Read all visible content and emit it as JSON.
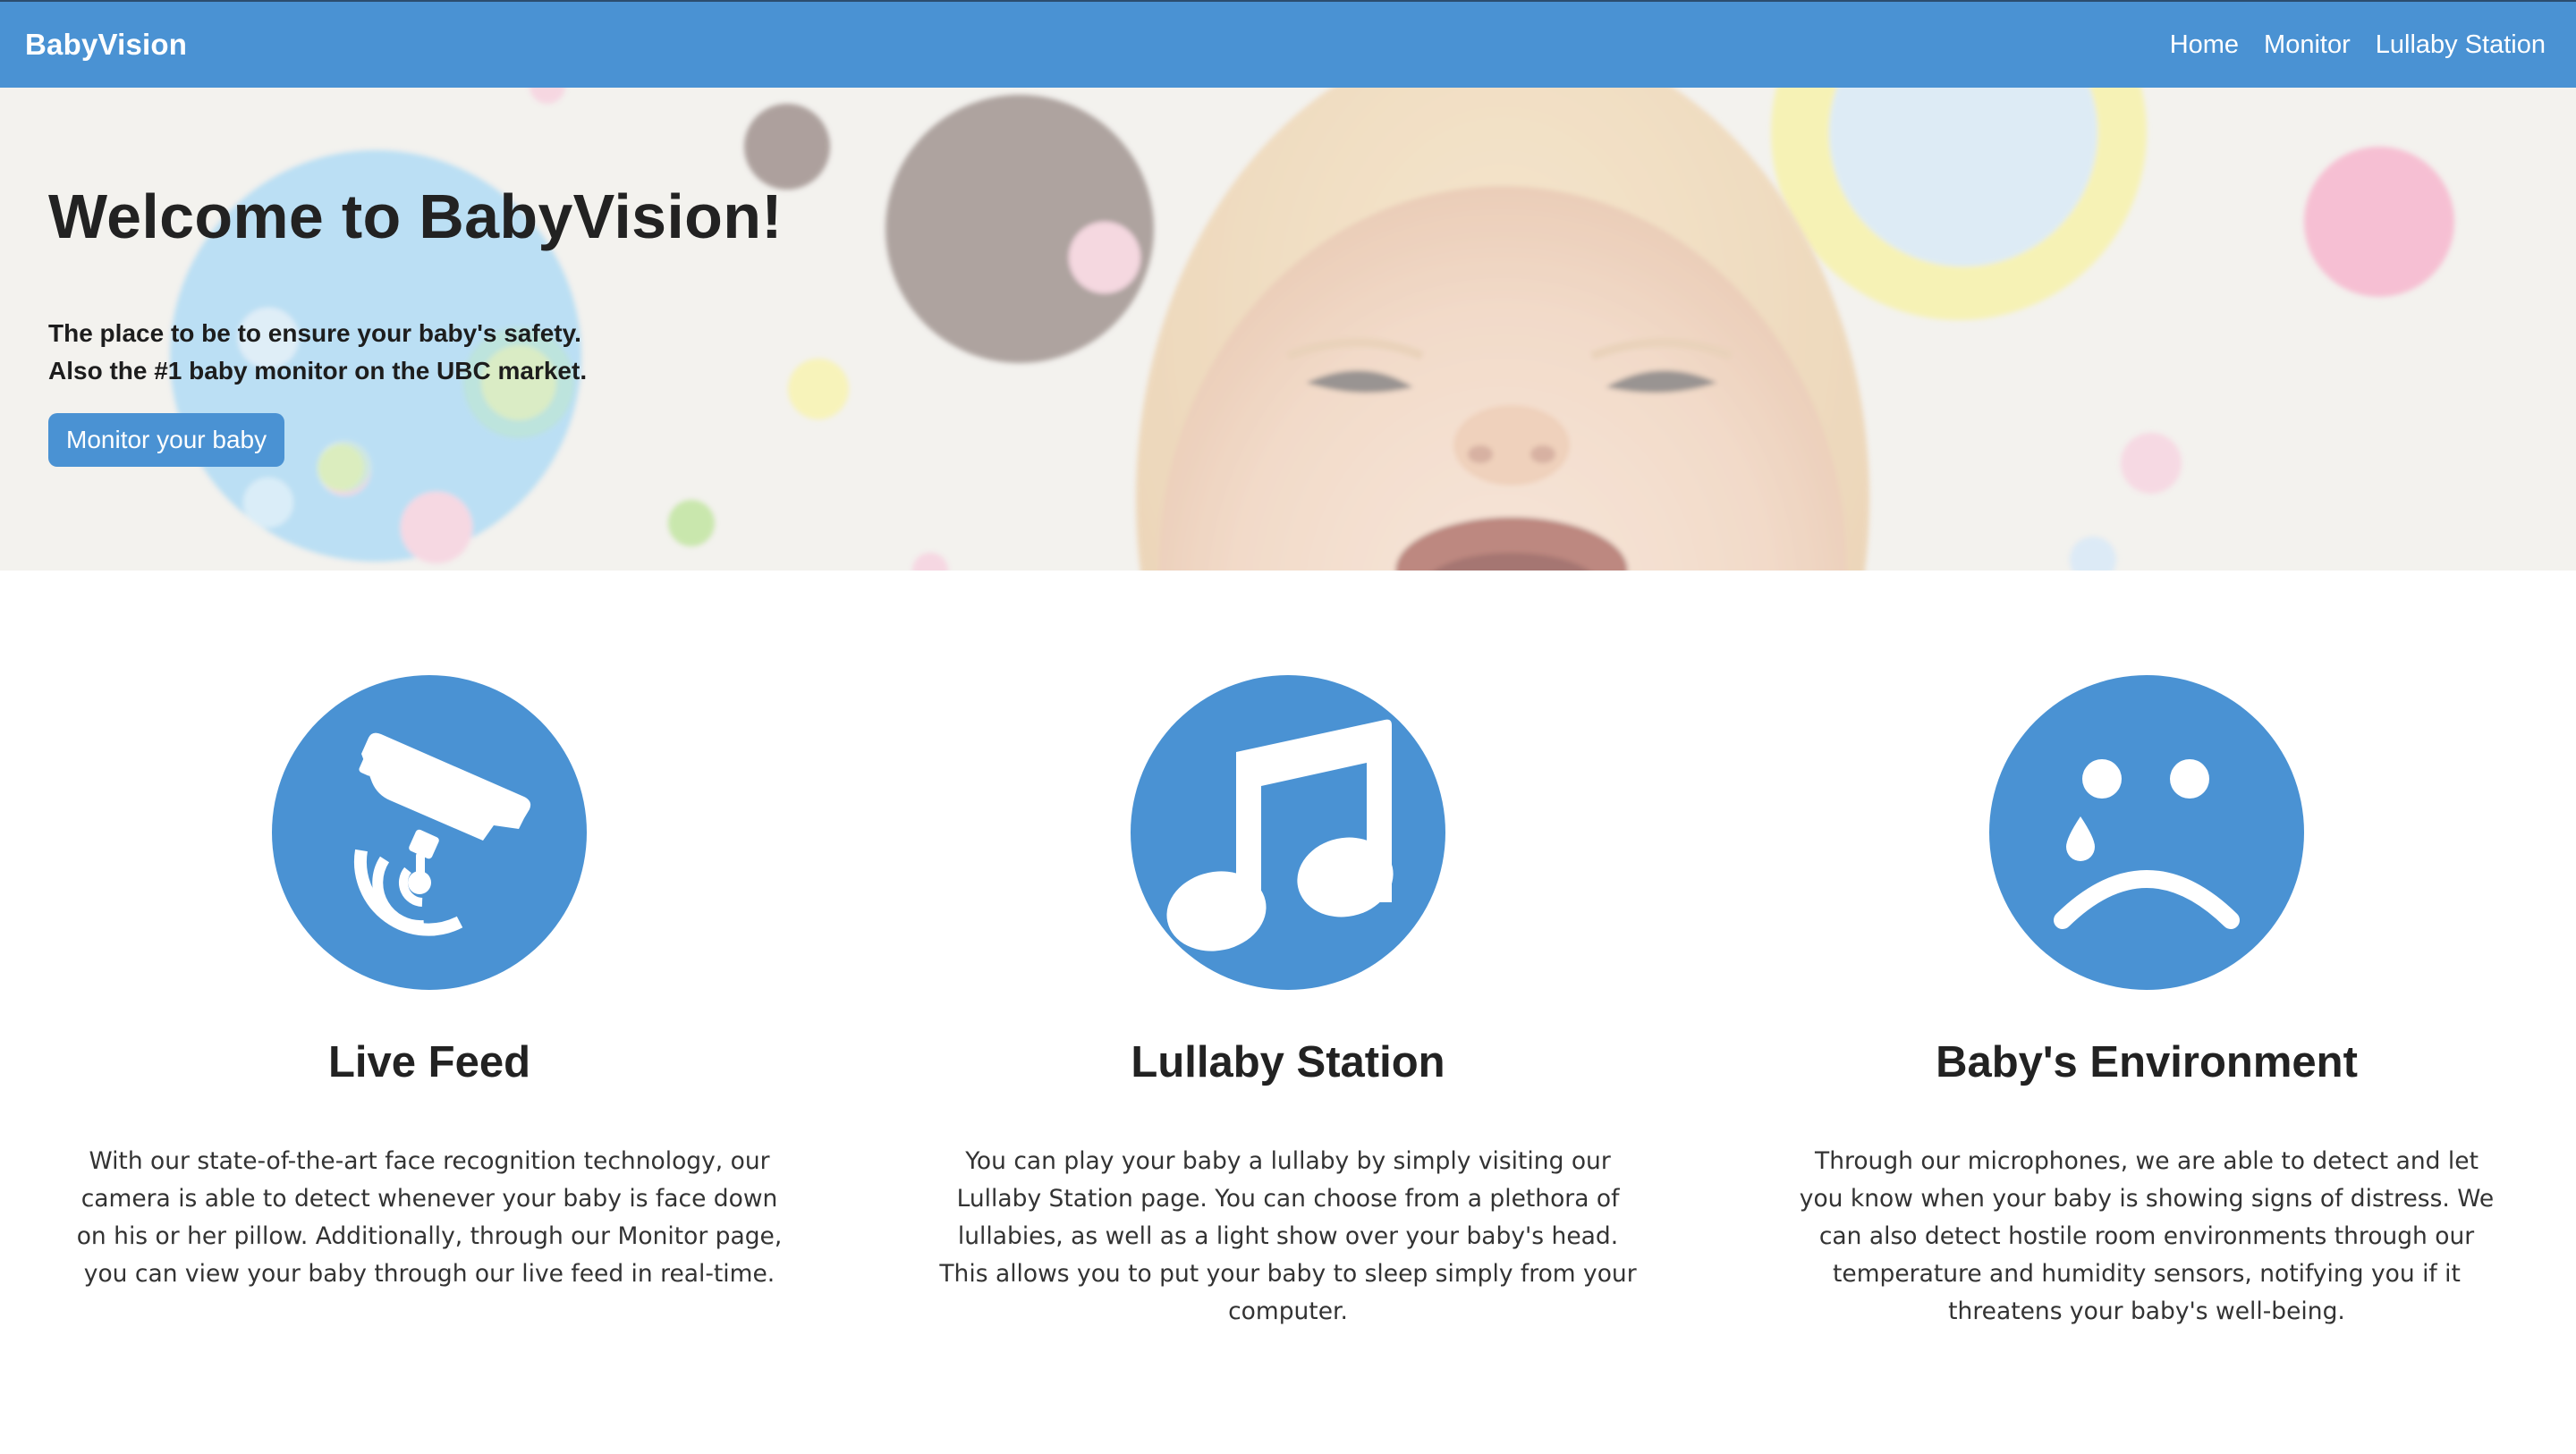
{
  "navbar": {
    "brand": "BabyVision",
    "links": [
      "Home",
      "Monitor",
      "Lullaby Station"
    ]
  },
  "hero": {
    "title": "Welcome to BabyVision!",
    "line1": "The place to be to ensure your baby's safety.",
    "line2": "Also the #1 baby monitor on the UBC market.",
    "button_label": "Monitor your baby"
  },
  "features": [
    {
      "icon": "security-camera-icon",
      "title": "Live Feed",
      "text": "With our state-of-the-art face recognition technology, our camera is able to detect whenever your baby is face down on his or her pillow. Additionally, through our Monitor page, you can view your baby through our live feed in real-time."
    },
    {
      "icon": "music-note-icon",
      "title": "Lullaby Station",
      "text": "You can play your baby a lullaby by simply visiting our Lullaby Station page. You can choose from a plethora of lullabies, as well as a light show over your baby's head. This allows you to put your baby to sleep simply from your computer."
    },
    {
      "icon": "crying-face-icon",
      "title": "Baby's Environment",
      "text": "Through our microphones, we are able to detect and let you know when your baby is showing signs of distress. We can also detect hostile room environments through our temperature and humidity sensors, notifying you if it threatens your baby's well-being."
    }
  ],
  "colors": {
    "primary": "#4a92d3",
    "text": "#222222"
  }
}
